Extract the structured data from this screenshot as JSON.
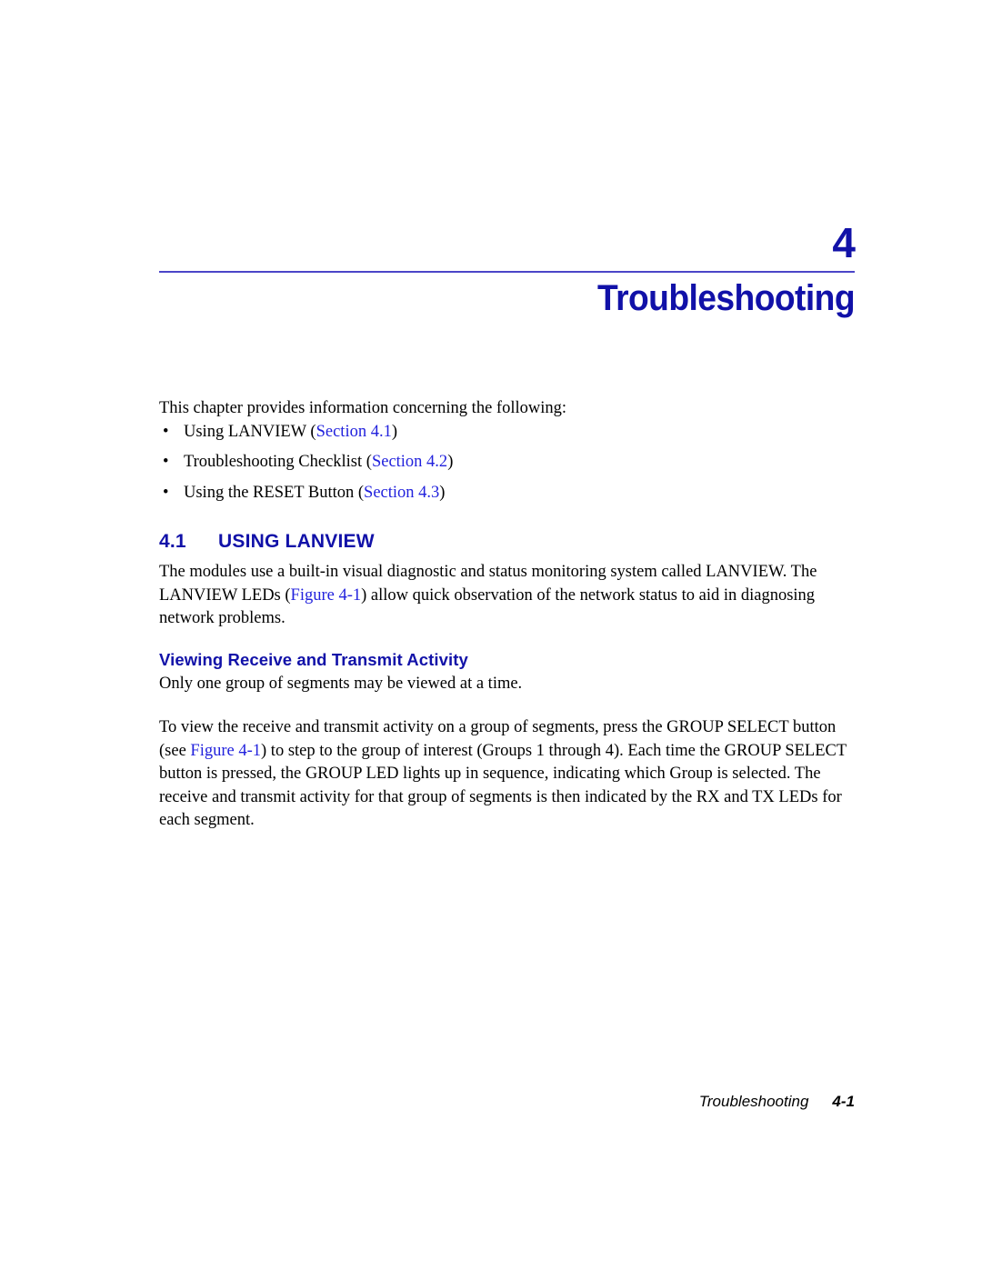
{
  "chapter": {
    "number": "4",
    "title": "Troubleshooting"
  },
  "colors": {
    "heading_blue": "#1111A8",
    "link_blue": "#2222DD",
    "rule_blue": "#4B45C8",
    "body_black": "#000000"
  },
  "intro": {
    "lead": "This chapter provides information concerning the following:",
    "bullet_glyph": "•",
    "bullets": [
      {
        "text_before": "Using LANVIEW (",
        "link": "Section 4.1",
        "text_after": ")"
      },
      {
        "text_before": "Troubleshooting Checklist (",
        "link": "Section 4.2",
        "text_after": ")"
      },
      {
        "text_before": "Using the RESET Button (",
        "link": "Section 4.3",
        "text_after": ")"
      }
    ]
  },
  "section": {
    "number": "4.1",
    "title": "USING LANVIEW",
    "paragraph_1_before": "The modules use a built-in visual diagnostic and status monitoring system called LANVIEW. The LANVIEW LEDs (",
    "paragraph_1_link": "Figure 4-1",
    "paragraph_1_after": ") allow quick observation of the network status to aid in diagnosing network problems.",
    "subheading": "Viewing Receive and Transmit Activity",
    "paragraph_2": "Only one group of segments may be viewed at a time.",
    "paragraph_3_before": "To view the receive and transmit activity on a group of segments, press the GROUP SELECT button (see ",
    "paragraph_3_link": "Figure 4-1",
    "paragraph_3_after": ") to step to the group of interest (Groups 1 through 4). Each time the GROUP SELECT button is pressed, the GROUP LED lights up in sequence, indicating which Group is selected. The receive and transmit activity for that group of segments is then indicated by the RX and TX LEDs for each segment."
  },
  "footer": {
    "title": "Troubleshooting",
    "page": "4-1"
  }
}
